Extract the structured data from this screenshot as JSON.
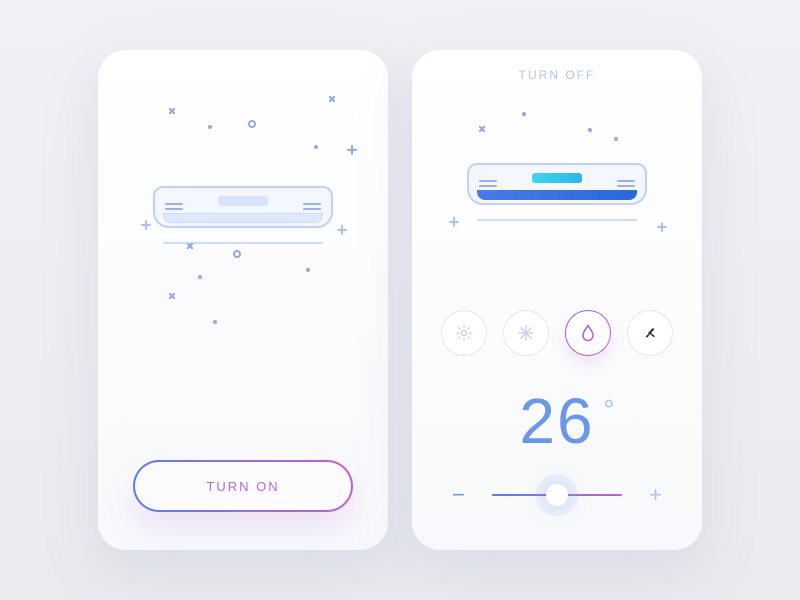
{
  "left_card": {
    "turn_on_label": "TURN ON"
  },
  "right_card": {
    "turn_off_label": "TURN OFF",
    "modes": {
      "sun": "sun-icon",
      "snowflake": "snowflake-icon",
      "humidity": "humidity-icon",
      "fan": "fan-icon"
    },
    "temperature": "26",
    "slider": {
      "minus": "−",
      "plus": "+"
    }
  },
  "colors": {
    "grad_start": "#5a7eea",
    "grad_end": "#c85dd6",
    "text_blue": "#6a98e8"
  }
}
